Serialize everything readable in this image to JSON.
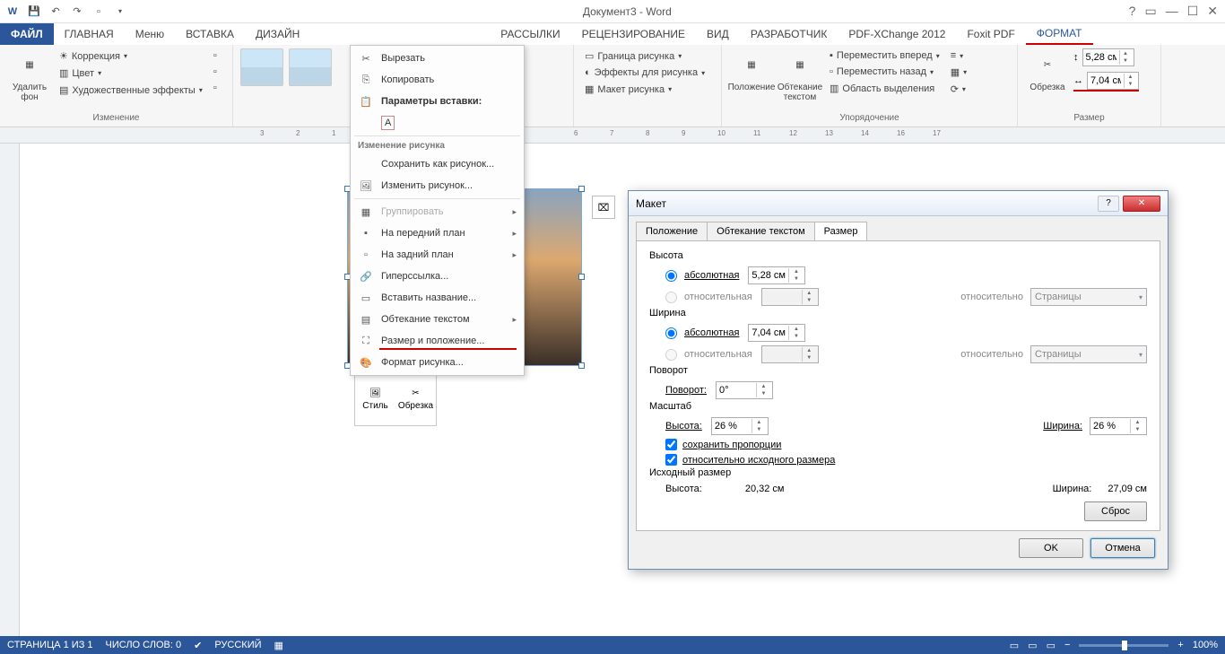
{
  "title": "Документ3 - Word",
  "qat_items": [
    "save",
    "undo",
    "redo",
    "new"
  ],
  "tabs": [
    "ФАЙЛ",
    "ГЛАВНАЯ",
    "Меню",
    "ВСТАВКА",
    "ДИЗАЙН",
    "",
    "РАССЫЛКИ",
    "РЕЦЕНЗИРОВАНИЕ",
    "ВИД",
    "РАЗРАБОТЧИК",
    "PDF-XChange 2012",
    "Foxit PDF",
    "ФОРМАТ"
  ],
  "ribbon": {
    "remove_bg": "Удалить\nфон",
    "correction": "Коррекция",
    "color": "Цвет",
    "effects": "Художественные эффекты",
    "group1_label": "Изменение",
    "border": "Граница рисунка",
    "effects2": "Эффекты для рисунка",
    "layout": "Макет рисунка",
    "position": "Положение",
    "wrap": "Обтекание текстом",
    "forward": "Переместить вперед",
    "backward": "Переместить назад",
    "selection": "Область выделения",
    "group2_label": "Упорядочение",
    "crop": "Обрезка",
    "height": "5,28 см",
    "width": "7,04 см",
    "group3_label": "Размер"
  },
  "ctx": {
    "cut": "Вырезать",
    "copy": "Копировать",
    "paste_opts": "Параметры вставки:",
    "change_pic_hdr": "Изменение рисунка",
    "save_as_pic": "Сохранить как рисунок...",
    "change_pic": "Изменить рисунок...",
    "group": "Группировать",
    "front": "На передний план",
    "back": "На задний план",
    "hyper": "Гиперссылка...",
    "caption": "Вставить название...",
    "wrap": "Обтекание текстом",
    "size_pos": "Размер и положение...",
    "format": "Формат рисунка..."
  },
  "mini": {
    "style": "Стиль",
    "crop": "Обрезка"
  },
  "dialog": {
    "title": "Макет",
    "tab_pos": "Положение",
    "tab_wrap": "Обтекание текстом",
    "tab_size": "Размер",
    "height_sec": "Высота",
    "width_sec": "Ширина",
    "abs": "абсолютная",
    "rel": "относительная",
    "rel_to": "относительно",
    "page": "Страницы",
    "h_abs": "5,28 см",
    "w_abs": "7,04 см",
    "rotate_sec": "Поворот",
    "rotate_l": "Поворот:",
    "rotate_v": "0°",
    "scale_sec": "Масштаб",
    "scale_h_l": "Высота:",
    "scale_h_v": "26 %",
    "scale_w_l": "Ширина:",
    "scale_w_v": "26 %",
    "lock": "сохранить пропорции",
    "relorig": "относительно исходного размера",
    "orig_sec": "Исходный размер",
    "orig_h_l": "Высота:",
    "orig_h_v": "20,32 см",
    "orig_w_l": "Ширина:",
    "orig_w_v": "27,09 см",
    "reset": "Сброс",
    "ok": "OK",
    "cancel": "Отмена"
  },
  "status": {
    "page": "СТРАНИЦА 1 ИЗ 1",
    "words": "ЧИСЛО СЛОВ: 0",
    "lang": "РУССКИЙ",
    "zoom": "100%"
  }
}
